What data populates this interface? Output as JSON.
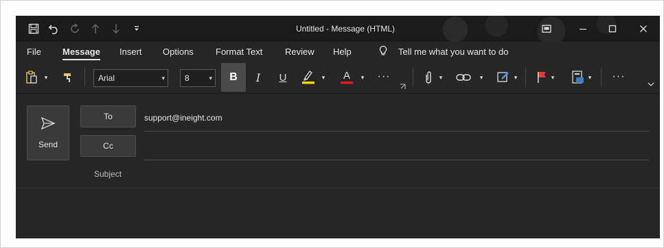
{
  "window": {
    "title": "Untitled  -  Message (HTML)"
  },
  "quick_access": [
    {
      "name": "save-icon",
      "glyph": "🖫"
    },
    {
      "name": "undo-icon",
      "glyph": "↶"
    },
    {
      "name": "redo-icon",
      "glyph": "↻"
    },
    {
      "name": "arrow-up-icon",
      "glyph": "↑"
    },
    {
      "name": "arrow-down-icon",
      "glyph": "↓"
    },
    {
      "name": "customize-qat-icon",
      "glyph": "▾"
    }
  ],
  "window_controls": {
    "ribbon_display": "⧉",
    "minimize": "–",
    "maximize": "☐",
    "close": "✕"
  },
  "menu": {
    "file": "File",
    "message": "Message",
    "insert": "Insert",
    "options": "Options",
    "format_text": "Format Text",
    "review": "Review",
    "help": "Help",
    "tell_me": "Tell me what you want to do"
  },
  "ribbon": {
    "font_name": "Arial",
    "font_size": "8",
    "bold": "B",
    "italic": "I",
    "underline": "U",
    "highlight_color": "#f2d600",
    "font_color": "#e21c1c",
    "flag_color": "#e23a3a"
  },
  "compose": {
    "send_label": "Send",
    "to_label": "To",
    "cc_label": "Cc",
    "subject_label": "Subject",
    "to_value": "support@ineight.com",
    "cc_value": ""
  }
}
